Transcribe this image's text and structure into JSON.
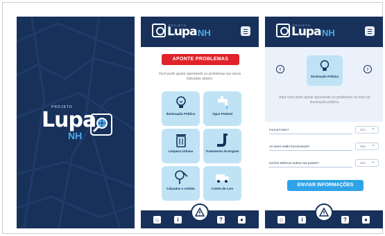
{
  "splash": {
    "small_label": "PROJETO",
    "logo_main": "Lupa",
    "logo_sub": "NH",
    "magnifier_icon": "magnifier-globe-icon"
  },
  "header": {
    "small_label": "PROJETO",
    "logo_main": "Lupa",
    "logo_sub": "NH",
    "menu_icon": "menu-icon"
  },
  "home": {
    "cta_label": "APONTE PROBLEMAS",
    "intro_text": "Você pode ajudar apontando os problemas nas áreas indicadas abaixo:",
    "categories": [
      {
        "label": "Iluminação Pública",
        "icon": "lightbulb-icon"
      },
      {
        "label": "Água Potável",
        "icon": "faucet-icon"
      },
      {
        "label": "Limpeza Urbana",
        "icon": "trash-can-icon"
      },
      {
        "label": "Tratamento de Esgoto",
        "icon": "pipe-icon"
      },
      {
        "label": "Calçadas e Asfalto",
        "icon": "road-sign-icon"
      },
      {
        "label": "Coleta de Lixo",
        "icon": "garbage-truck-icon"
      }
    ]
  },
  "detail": {
    "category_label": "Iluminação Pública",
    "category_icon": "lightbulb-icon",
    "description": "Aqui você pode ajudar apontando os problemas na área de iluminação pública.",
    "questions": [
      {
        "text": "Fornul Fonte?",
        "value": "Sim"
      },
      {
        "text": "As luzes estão funcionando?",
        "value": "Não"
      },
      {
        "text": "Há fios elétricos soltos nos postes?",
        "value": "Sim"
      }
    ],
    "submit_label": "ENVIAR INFORMAÇÕES"
  },
  "footer": {
    "icons": [
      "home-icon",
      "info-icon",
      "warning-icon",
      "help-icon",
      "user-icon"
    ],
    "info_glyph": "i",
    "help_glyph": "?"
  },
  "colors": {
    "navy": "#17315a",
    "accent_blue": "#4fa9e8",
    "card_bg": "#bfe3f5",
    "cta_red": "#e0222a",
    "cta_blue": "#2ea3e8"
  }
}
